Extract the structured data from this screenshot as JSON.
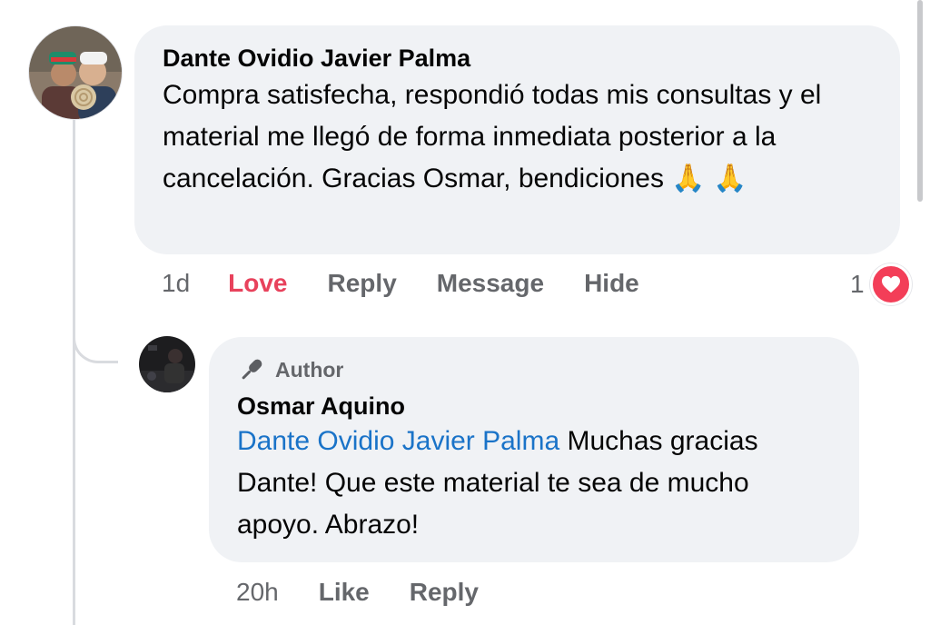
{
  "comment": {
    "author": "Dante Ovidio Javier Palma",
    "text": "Compra satisfecha, respondió todas mis consultas y el material me llegó de forma inmediata posterior a la cancelación. Gracias Osmar, bendiciones 🙏 🙏",
    "time": "1d",
    "actions": {
      "love": "Love",
      "reply": "Reply",
      "message": "Message",
      "hide": "Hide"
    },
    "reaction_count": "1",
    "reaction_icon": "heart-icon"
  },
  "reply": {
    "badge": "Author",
    "badge_icon": "microphone-icon",
    "author": "Osmar Aquino",
    "mention": "Dante Ovidio Javier Palma",
    "text": " Muchas gracias Dante! Que este material te sea de mucho apoyo. Abrazo!",
    "time": "20h",
    "actions": {
      "like": "Like",
      "reply": "Reply"
    }
  },
  "colors": {
    "bubble": "#f0f2f5",
    "love": "#e8425c",
    "mention": "#1a73c8",
    "muted": "#65676b"
  }
}
